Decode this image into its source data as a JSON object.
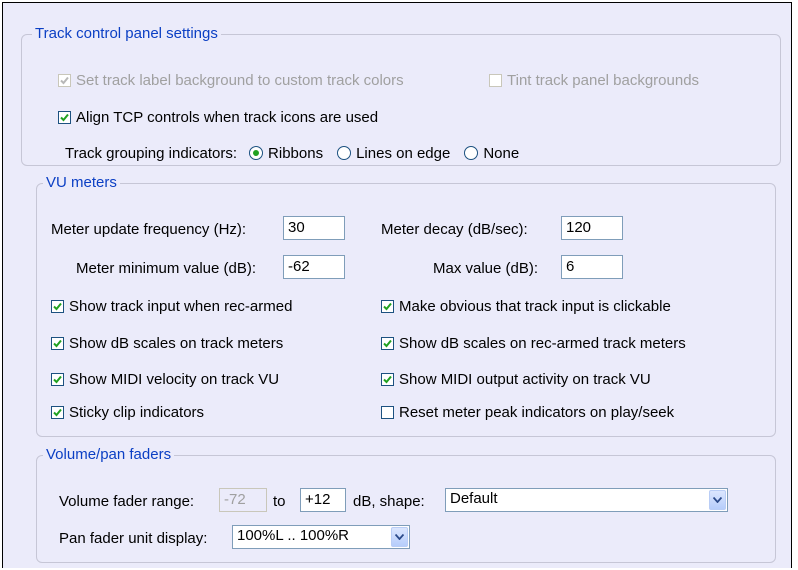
{
  "tcp": {
    "legend": "Track control panel settings",
    "label_bg": {
      "label": "Set track label background to custom track colors",
      "checked": true,
      "disabled": true
    },
    "tint_bg": {
      "label": "Tint track panel backgrounds",
      "checked": false,
      "disabled": true
    },
    "align_tcp": {
      "label": "Align TCP controls when track icons are used",
      "checked": true
    },
    "grouping": {
      "label": "Track grouping indicators:",
      "options": [
        {
          "label": "Ribbons",
          "selected": true
        },
        {
          "label": "Lines on edge",
          "selected": false
        },
        {
          "label": "None",
          "selected": false
        }
      ]
    }
  },
  "vu": {
    "legend": "VU meters",
    "update_freq": {
      "label": "Meter update frequency (Hz):",
      "value": "30"
    },
    "decay": {
      "label": "Meter decay (dB/sec):",
      "value": "120"
    },
    "min_value": {
      "label": "Meter minimum value (dB):",
      "value": "-62"
    },
    "max_value": {
      "label": "Max value (dB):",
      "value": "6"
    },
    "checkboxes": [
      {
        "label": "Show track input when rec-armed",
        "checked": true
      },
      {
        "label": "Make obvious that track input is clickable",
        "checked": true
      },
      {
        "label": "Show dB scales on track meters",
        "checked": true
      },
      {
        "label": "Show dB scales on rec-armed track meters",
        "checked": true
      },
      {
        "label": "Show MIDI velocity on track VU",
        "checked": true
      },
      {
        "label": "Show MIDI output activity on track VU",
        "checked": true
      },
      {
        "label": "Sticky clip indicators",
        "checked": true
      },
      {
        "label": "Reset meter peak indicators on play/seek",
        "checked": false
      }
    ]
  },
  "faders": {
    "legend": "Volume/pan faders",
    "range_label": "Volume fader range:",
    "range_min": "-72",
    "to_label": "to",
    "range_max": "+12",
    "shape_label": "dB, shape:",
    "shape_value": "Default",
    "pan_label": "Pan fader unit display:",
    "pan_value": "100%L .. 100%R"
  }
}
